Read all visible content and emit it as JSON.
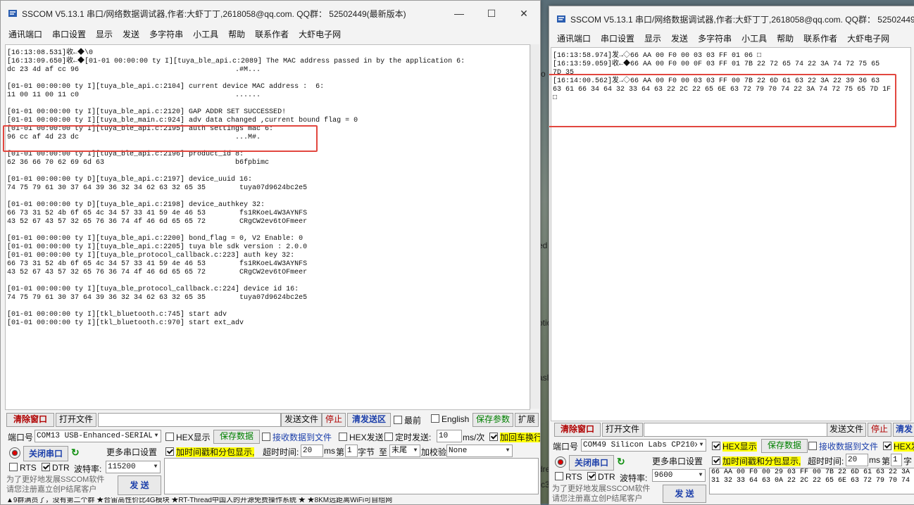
{
  "colors": {
    "highlight": "#e2473f",
    "yellow": "#ffff00",
    "close_red": "#b00000",
    "green": "#008000",
    "blue": "#1c3faa"
  },
  "bg": {
    "frag1": "ro",
    "frag2": "ed",
    "frag3": "otio",
    "frag4": "asl",
    "frag5": "dre",
    "frag6": "rc3"
  },
  "taskbar": {
    "text": "▲9群满员了，没有第二个群 ★合宙高性价比4G模块 ★RT-Thread中国人的开源免费操作系统 ★ ★8KM远距离WiFi可自组网"
  },
  "left": {
    "title": "SSCOM V5.13.1 串口/网络数据调试器,作者:大虾丁丁,2618058@qq.com. QQ群： 52502449(最新版本)",
    "menu": [
      "通讯端口",
      "串口设置",
      "显示",
      "发送",
      "多字符串",
      "小工具",
      "帮助",
      "联系作者",
      "大虾电子网"
    ],
    "terminal": "[16:13:08.531]收←◆\\0\n[16:13:09.650]收←◆[01-01 00:00:00 ty I][tuya_ble_api.c:2089] The MAC address passed in by the application 6:\ndc 23 4d af cc 96                                     .#M...\n\n[01-01 00:00:00 ty I][tuya_ble_api.c:2104] current device MAC address :  6:\n11 00 11 00 11 c0                                     ......\n\n[01-01 00:00:00 ty I][tuya_ble_api.c:2120] GAP ADDR SET SUCCESSED!\n[01-01 00:00:00 ty I][tuya_ble_main.c:924] adv data changed ,current bound flag = 0\n[01-01 00:00:00 ty I][tuya_ble_api.c:2195] auth settings mac 6:\n96 cc af 4d 23 dc                                     ...M#.\n\n[01-01 00:00:00 ty I][tuya_ble_api.c:2196] product_id 8:\n62 36 66 70 62 69 6d 63                               b6fpbimc\n\n[01-01 00:00:00 ty D][tuya_ble_api.c:2197] device_uuid 16:\n74 75 79 61 30 37 64 39 36 32 34 62 63 32 65 35        tuya07d9624bc2e5\n\n[01-01 00:00:00 ty D][tuya_ble_api.c:2198] device_authkey 32:\n66 73 31 52 4b 6f 65 4c 34 57 33 41 59 4e 46 53        fs1RKoeL4W3AYNFS\n43 52 67 43 57 32 65 76 36 74 4f 46 6d 65 65 72        CRgCW2ev6tOFmeer\n\n[01-01 00:00:00 ty I][tuya_ble_api.c:2200] bond_flag = 0, V2 Enable: 0\n[01-01 00:00:00 ty I][tuya_ble_api.c:2205] tuya ble sdk version : 2.0.0\n[01-01 00:00:00 ty I][tuya_ble_protocol_callback.c:223] auth key 32:\n66 73 31 52 4b 6f 65 4c 34 57 33 41 59 4e 46 53        fs1RKoeL4W3AYNFS\n43 52 67 43 57 32 65 76 36 74 4f 46 6d 65 65 72        CRgCW2ev6tOFmeer\n\n[01-01 00:00:00 ty I][tuya_ble_protocol_callback.c:224] device id 16:\n74 75 79 61 30 37 64 39 36 32 34 62 63 32 65 35        tuya07d9624bc2e5\n\n[01-01 00:00:00 ty I][tkl_bluetooth.c:745] start adv\n[01-01 00:00:00 ty I][tkl_bluetooth.c:970] start ext_adv",
    "clear_window": "清除窗口",
    "open_file": "打开文件",
    "send_file": "发送文件",
    "stop": "停止",
    "clear_send": "清发送区",
    "top_most": "最前",
    "english": "English",
    "save_params": "保存参数",
    "expand": "扩展",
    "port_label": "端口号",
    "port_value": "COM13 USB-Enhanced-SERIAL CH343",
    "hex_display": "HEX显示",
    "save_data": "保存数据",
    "recv_to_file": "接收数据到文件",
    "hex_send": "HEX发送",
    "timed_send": "定时发送:",
    "interval": "10",
    "interval_unit": "ms/次",
    "add_crlf": "加回车换行",
    "close_port": "关闭串口",
    "more_settings": "更多串口设置",
    "timestamp": "加时间戳和分包显示,",
    "timeout_label": "超时时间:",
    "timeout": "20",
    "ms": "ms",
    "nth": "第",
    "byte_index": "1",
    "byte": "字节",
    "to": "至",
    "end_value": "末尾",
    "checksum": "加校验",
    "checksum_value": "None",
    "rts": "RTS",
    "dtr": "DTR",
    "baud_label": "波特率:",
    "baud": "115200",
    "promo1": "为了更好地发展SSCOM软件",
    "promo2": "请您注册嘉立创P结尾客户",
    "send": "发 送"
  },
  "right": {
    "title": "SSCOM V5.13.1 串口/网络数据调试器,作者:大虾丁丁,2618058@qq.com. QQ群： 52502449(最新版本)",
    "menu": [
      "通讯端口",
      "串口设置",
      "显示",
      "发送",
      "多字符串",
      "小工具",
      "帮助",
      "联系作者",
      "大虾电子网"
    ],
    "terminal": "[16:13:58.974]发→◇66 AA 00 F0 00 03 03 FF 01 06 □\n[16:13:59.059]收←◆66 AA 00 F0 00 0F 03 FF 01 7B 22 72 65 74 22 3A 74 72 75 65\n7D 35\n[16:14:00.562]发→◇66 AA 00 F0 00 03 03 FF 00 7B 22 6D 61 63 22 3A 22 39 36 63\n63 61 66 34 64 32 33 64 63 22 2C 22 65 6E 63 72 79 70 74 22 3A 74 72 75 65 7D 1F\n□",
    "clear_window": "清除窗口",
    "open_file": "打开文件",
    "send_file": "发送文件",
    "stop": "停止",
    "clear_send": "清发",
    "port_label": "端口号",
    "port_value": "COM49 Silicon Labs CP210x U",
    "hex_display": "HEX显示",
    "save_data": "保存数据",
    "recv_to_file": "接收数据到文件",
    "hex_send": "HEX发",
    "close_port": "关闭串口",
    "more_settings": "更多串口设置",
    "timestamp": "加时间戳和分包显示,",
    "timeout_label": "超时时间:",
    "timeout": "20",
    "ms": "ms",
    "nth": "第",
    "byte_index": "1",
    "byte": "字",
    "rts": "RTS",
    "dtr": "DTR",
    "baud_label": "波特率:",
    "baud": "9600",
    "send_area": "66 AA 00 F0 00 29 03 FF 00 7B 22 6D 61 63 22 3A 2\n31 32 33 64 63 0A 22 2C 22 65 6E 63 72 79 70 74 2",
    "promo1": "为了更好地发展SSCOM软件",
    "promo2": "请您注册嘉立创P结尾客户",
    "send": "发 送"
  }
}
